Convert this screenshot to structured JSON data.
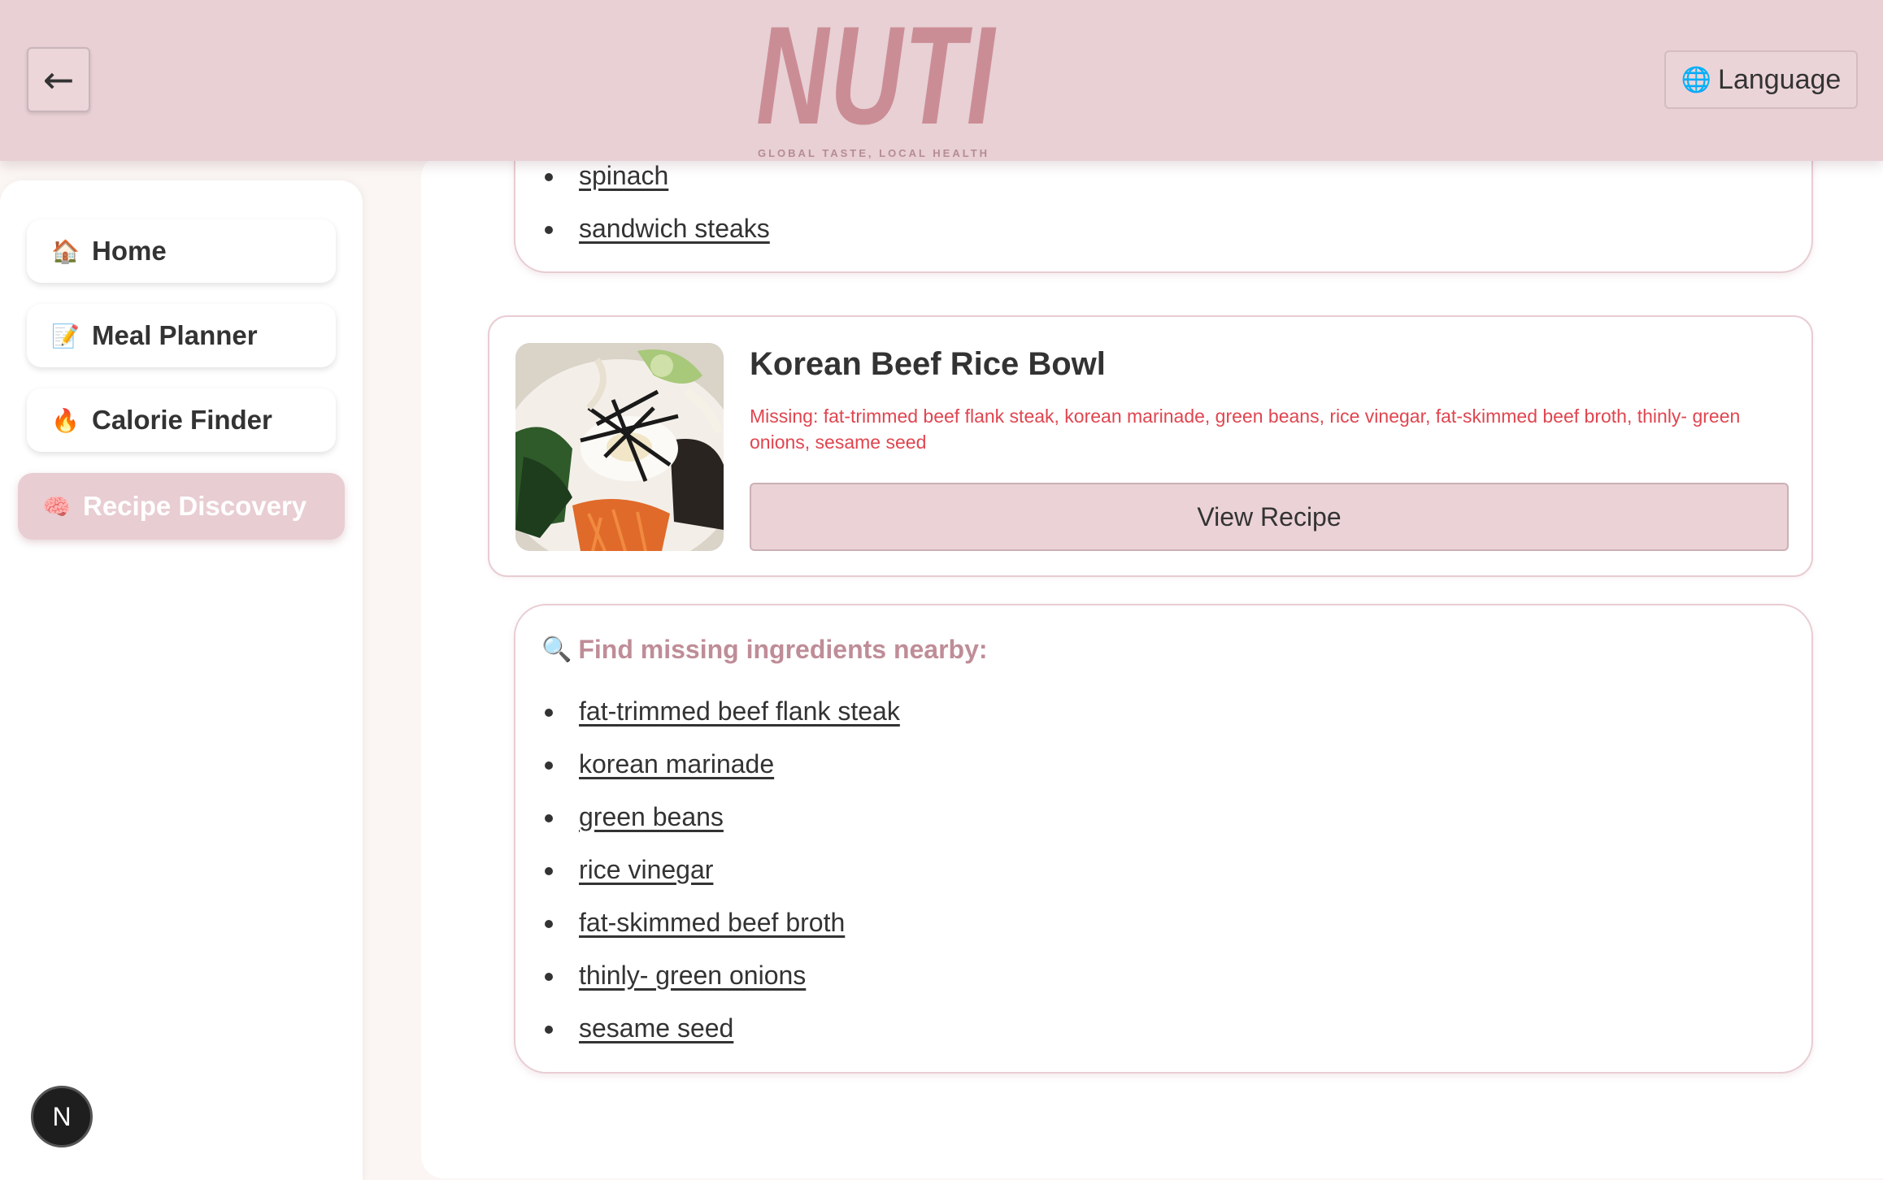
{
  "header": {
    "back_label": "←",
    "logo_text": "NUTI",
    "logo_tagline": "GLOBAL TASTE, LOCAL HEALTH",
    "language_label": "Language",
    "language_icon": "globe-icon"
  },
  "sidebar": {
    "items": [
      {
        "label": "Home",
        "icon": "🏠",
        "icon_name": "house-icon"
      },
      {
        "label": "Meal Planner",
        "icon": "📝",
        "icon_name": "memo-icon"
      },
      {
        "label": "Calorie Finder",
        "icon": "🔥",
        "icon_name": "fire-icon"
      },
      {
        "label": "Recipe Discovery",
        "icon": "🧠",
        "icon_name": "brain-icon",
        "active": true
      }
    ],
    "badge_letter": "N"
  },
  "previous_card": {
    "ingredients": [
      "spinach",
      "sandwich steaks"
    ]
  },
  "recipe": {
    "title": "Korean Beef Rice Bowl",
    "missing_text": "Missing: fat-trimmed beef flank steak, korean marinade, green beans, rice vinegar, fat-skimmed beef broth, thinly- green onions, sesame seed",
    "view_button": "View Recipe"
  },
  "missing_section": {
    "title": "Find missing ingredients nearby:",
    "icon": "🔍",
    "ingredients": [
      "fat-trimmed beef flank steak",
      "korean marinade",
      "green beans",
      "rice vinegar",
      "fat-skimmed beef broth",
      "thinly- green onions",
      "sesame seed"
    ]
  },
  "colors": {
    "header_bg": "#e8d0d5",
    "accent_pink": "#e8cdd2",
    "missing_red": "#e0454f",
    "logo_pink": "#c8868f"
  }
}
